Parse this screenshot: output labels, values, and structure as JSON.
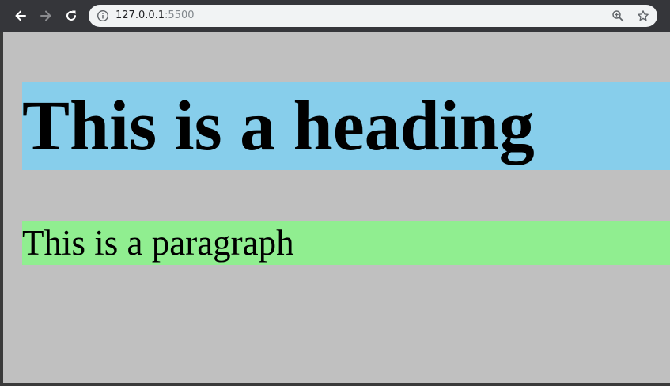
{
  "browser": {
    "url_host": "127.0.0.1",
    "url_port": ":5500",
    "icons": {
      "back": "arrow-left-icon",
      "forward": "arrow-right-icon",
      "reload": "reload-icon",
      "site_info": "info-icon",
      "zoom": "zoom-in-icon",
      "bookmark": "star-icon"
    }
  },
  "page": {
    "heading": "This is a heading",
    "paragraph": "This is a paragraph"
  },
  "colors": {
    "toolbar": "#35363a",
    "omnibox": "#f1f3f4",
    "page_background": "#c0c0c0",
    "heading_background": "#87ceeb",
    "paragraph_background": "#90ee90"
  }
}
